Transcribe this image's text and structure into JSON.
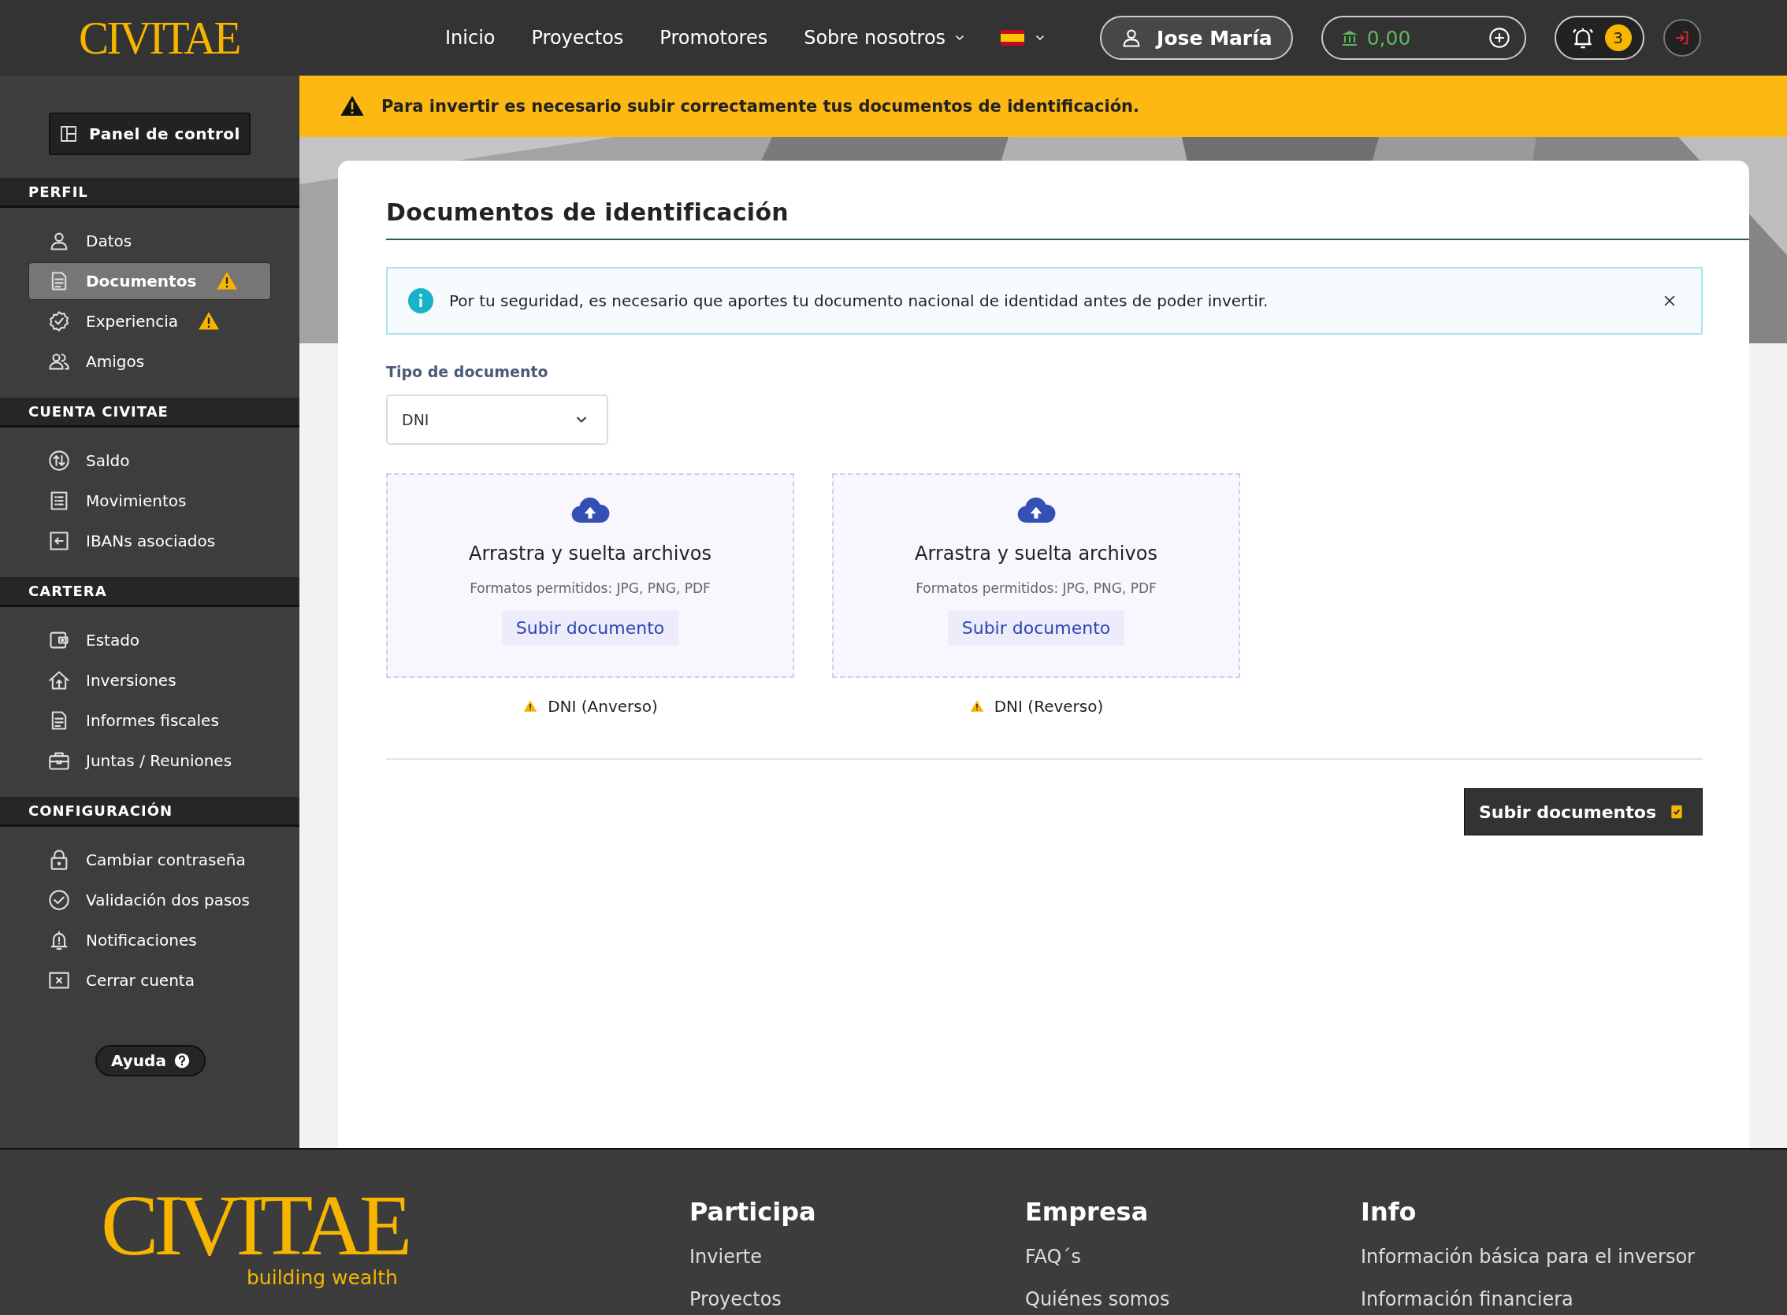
{
  "header": {
    "logo": "CIVITAE",
    "nav": [
      {
        "label": "Inicio",
        "dropdown": false
      },
      {
        "label": "Proyectos",
        "dropdown": false
      },
      {
        "label": "Promotores",
        "dropdown": false
      },
      {
        "label": "Sobre nosotros",
        "dropdown": true
      }
    ],
    "user": {
      "name": "Jose María"
    },
    "balance": {
      "amount": "0,00"
    },
    "notifications": {
      "count": "3"
    }
  },
  "alert": {
    "text": "Para invertir es necesario subir correctamente tus documentos de identificación."
  },
  "sidebar": {
    "panel_button": "Panel de control",
    "sections": [
      {
        "title": "PERFIL",
        "items": [
          {
            "label": "Datos",
            "selected": false,
            "warning": false
          },
          {
            "label": "Documentos",
            "selected": true,
            "warning": true
          },
          {
            "label": "Experiencia",
            "selected": false,
            "warning": true
          },
          {
            "label": "Amigos",
            "selected": false,
            "warning": false
          }
        ]
      },
      {
        "title": "CUENTA CIVITAE",
        "items": [
          {
            "label": "Saldo",
            "selected": false,
            "warning": false
          },
          {
            "label": "Movimientos",
            "selected": false,
            "warning": false
          },
          {
            "label": "IBANs asociados",
            "selected": false,
            "warning": false
          }
        ]
      },
      {
        "title": "CARTERA",
        "items": [
          {
            "label": "Estado",
            "selected": false,
            "warning": false
          },
          {
            "label": "Inversiones",
            "selected": false,
            "warning": false
          },
          {
            "label": "Informes fiscales",
            "selected": false,
            "warning": false
          },
          {
            "label": "Juntas / Reuniones",
            "selected": false,
            "warning": false
          }
        ]
      },
      {
        "title": "CONFIGURACIÓN",
        "items": [
          {
            "label": "Cambiar contraseña",
            "selected": false,
            "warning": false
          },
          {
            "label": "Validación dos pasos",
            "selected": false,
            "warning": false
          },
          {
            "label": "Notificaciones",
            "selected": false,
            "warning": false
          },
          {
            "label": "Cerrar cuenta",
            "selected": false,
            "warning": false
          }
        ]
      }
    ],
    "help_button": "Ayuda"
  },
  "main": {
    "title": "Documentos de identificación",
    "info": {
      "text": "Por tu seguridad, es necesario que aportes tu documento nacional de identidad antes de poder invertir."
    },
    "document_type": {
      "label": "Tipo de documento",
      "value": "DNI"
    },
    "dropzones": [
      {
        "title": "Arrastra y suelta archivos",
        "formats": "Formatos permitidos: JPG, PNG, PDF",
        "button": "Subir documento",
        "caption": "DNI (Anverso)",
        "warning": true
      },
      {
        "title": "Arrastra y suelta archivos",
        "formats": "Formatos permitidos: JPG, PNG, PDF",
        "button": "Subir documento",
        "caption": "DNI (Reverso)",
        "warning": true
      }
    ],
    "submit_button": "Subir documentos"
  },
  "footer": {
    "logo": "CIVITAE",
    "tagline": "building wealth",
    "columns": [
      {
        "heading": "Participa",
        "links": [
          "Invierte",
          "Proyectos"
        ]
      },
      {
        "heading": "Empresa",
        "links": [
          "FAQ´s",
          "Quiénes somos"
        ]
      },
      {
        "heading": "Info",
        "links": [
          "Información básica para el inversor",
          "Información financiera"
        ]
      }
    ]
  }
}
